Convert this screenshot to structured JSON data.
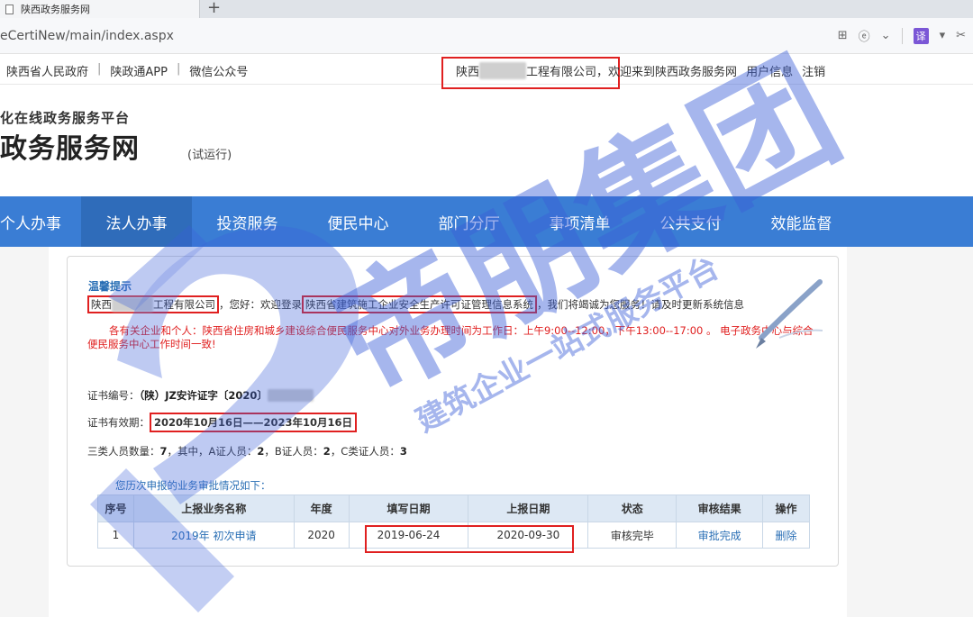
{
  "browser": {
    "tab_title": "陕西政务服务网",
    "new_tab": "+",
    "url": "eCertiNew/main/index.aspx",
    "translate_label": "译"
  },
  "topbar": {
    "links": [
      "陕西省人民政府",
      "陕政通APP",
      "微信公众号"
    ],
    "separator": "|",
    "company_prefix": "陕西",
    "company_suffix": "工程有限公司",
    "welcome": "，欢迎来到陕西政务服务网",
    "user_info": "用户信息",
    "logout": "注销"
  },
  "logo": {
    "subtitle": "化在线政务服务平台",
    "title": "政务服务网",
    "trial": "(试运行)"
  },
  "nav": {
    "items": [
      "个人办事",
      "法人办事",
      "投资服务",
      "便民中心",
      "部门分厅",
      "事项清单",
      "公共支付",
      "效能监督"
    ]
  },
  "main": {
    "tip_title": "温馨提示",
    "company_prefix": "陕西",
    "company_suffix": "工程有限公司",
    "greet_middle": "，您好：欢迎登录",
    "system_name": "陕西省建筑施工企业安全生产许可证管理信息系统",
    "greet_end": "，我们将竭诚为您服务！请及时更新系统信息",
    "notice": "各有关企业和个人：陕西省住房和城乡建设综合便民服务中心对外业务办理时间为工作日：上午9:00--12:00，下午13:00--17:00 。 电子政务中心与综合便民服务中心工作时间一致!",
    "cert_no_label": "证书编号：",
    "cert_no_value": "（陕）JZ安许证字〔2020〕",
    "validity_label": "证书有效期：",
    "validity_value": "2020年10月16日——2023年10月16日",
    "staff_label": "三类人员数量：",
    "staff_total": "7",
    "staff_mid": "，其中，A证人员：",
    "staff_a": "2",
    "staff_b_label": "，B证人员：",
    "staff_b": "2",
    "staff_c_label": "，C类证人员：",
    "staff_c": "3",
    "history": "您历次申报的业务审批情况如下：",
    "table": {
      "headers": [
        "序号",
        "上报业务名称",
        "年度",
        "填写日期",
        "上报日期",
        "状态",
        "审核结果",
        "操作"
      ],
      "rows": [
        [
          "1",
          "2019年 初次申请",
          "2020",
          "2019-06-24",
          "2020-09-30",
          "审核完毕",
          "审批完成",
          "删除"
        ]
      ]
    }
  },
  "watermark": {
    "text": "帝朋集团",
    "sub": "建筑企业一站式服务平台"
  },
  "colors": {
    "nav": "#3a7dd4",
    "nav_active": "#2f6cba",
    "red": "#e02020",
    "link": "#2a6fb5",
    "watermark": "#3b5fd8"
  }
}
